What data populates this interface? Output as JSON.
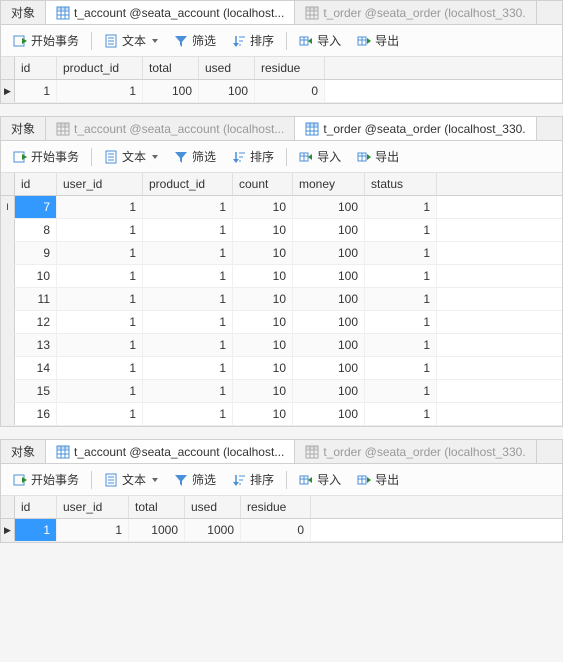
{
  "common": {
    "objects_tab": "对象",
    "toolbar": {
      "begin_tx": "开始事务",
      "text": "文本",
      "filter": "筛选",
      "sort": "排序",
      "import": "导入",
      "export": "导出"
    }
  },
  "panels": [
    {
      "tabs": [
        {
          "label": "t_account @seata_account (localhost...",
          "active": true
        },
        {
          "label": "t_order @seata_order (localhost_330.",
          "active": false,
          "disabled": true
        }
      ],
      "widths": [
        42,
        86,
        56,
        56,
        70
      ],
      "columns": [
        "id",
        "product_id",
        "total",
        "used",
        "residue"
      ],
      "rows": [
        {
          "marker": "▶",
          "selected_col": -1,
          "values": [
            1,
            1,
            100,
            100,
            0
          ]
        }
      ]
    },
    {
      "tabs": [
        {
          "label": "t_account @seata_account (localhost...",
          "active": false,
          "disabled": true
        },
        {
          "label": "t_order @seata_order (localhost_330.",
          "active": true
        }
      ],
      "widths": [
        42,
        86,
        90,
        60,
        72,
        72
      ],
      "columns": [
        "id",
        "user_id",
        "product_id",
        "count",
        "money",
        "status"
      ],
      "rows": [
        {
          "marker": "I",
          "selected_col": 0,
          "values": [
            7,
            1,
            1,
            10,
            100,
            1
          ]
        },
        {
          "marker": "",
          "selected_col": -1,
          "values": [
            8,
            1,
            1,
            10,
            100,
            1
          ]
        },
        {
          "marker": "",
          "selected_col": -1,
          "values": [
            9,
            1,
            1,
            10,
            100,
            1
          ]
        },
        {
          "marker": "",
          "selected_col": -1,
          "values": [
            10,
            1,
            1,
            10,
            100,
            1
          ]
        },
        {
          "marker": "",
          "selected_col": -1,
          "values": [
            11,
            1,
            1,
            10,
            100,
            1
          ]
        },
        {
          "marker": "",
          "selected_col": -1,
          "values": [
            12,
            1,
            1,
            10,
            100,
            1
          ]
        },
        {
          "marker": "",
          "selected_col": -1,
          "values": [
            13,
            1,
            1,
            10,
            100,
            1
          ]
        },
        {
          "marker": "",
          "selected_col": -1,
          "values": [
            14,
            1,
            1,
            10,
            100,
            1
          ]
        },
        {
          "marker": "",
          "selected_col": -1,
          "values": [
            15,
            1,
            1,
            10,
            100,
            1
          ]
        },
        {
          "marker": "",
          "selected_col": -1,
          "values": [
            16,
            1,
            1,
            10,
            100,
            1
          ]
        }
      ]
    },
    {
      "tabs": [
        {
          "label": "t_account @seata_account (localhost...",
          "active": true
        },
        {
          "label": "t_order @seata_order (localhost_330.",
          "active": false,
          "disabled": true
        }
      ],
      "widths": [
        42,
        72,
        56,
        56,
        70
      ],
      "columns": [
        "id",
        "user_id",
        "total",
        "used",
        "residue"
      ],
      "rows": [
        {
          "marker": "▶",
          "selected_col": 0,
          "values": [
            1,
            1,
            1000,
            1000,
            0
          ]
        }
      ]
    }
  ]
}
